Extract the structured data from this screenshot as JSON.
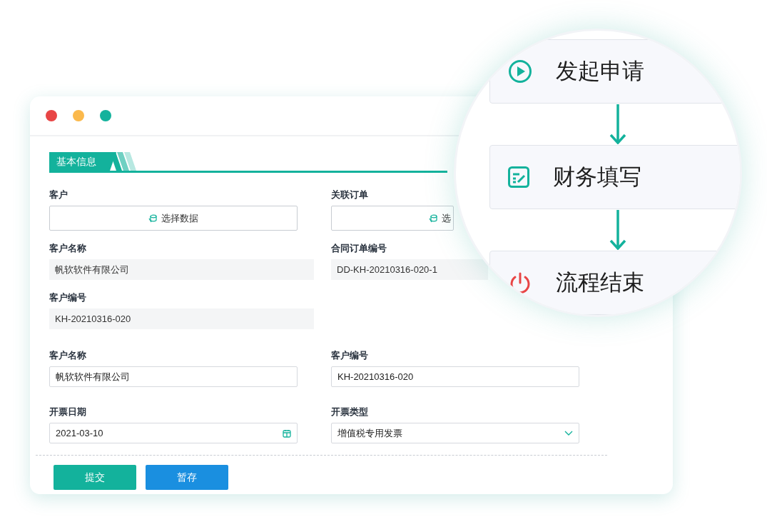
{
  "window": {
    "controls": [
      {
        "color": "#e84545"
      },
      {
        "color": "#fbb94c"
      },
      {
        "color": "#13b29c"
      }
    ]
  },
  "section": {
    "title": "基本信息"
  },
  "rows": [
    {
      "fields": [
        {
          "kind": "picker",
          "label": "客户",
          "button": "选择数据"
        },
        {
          "kind": "picker",
          "label": "关联订单",
          "button": "选"
        }
      ]
    },
    {
      "fields": [
        {
          "kind": "readonly",
          "label": "客户名称",
          "value": "帆软软件有限公司"
        },
        {
          "kind": "readonly",
          "label": "合同订单编号",
          "value": "DD-KH-20210316-020-1"
        }
      ]
    },
    {
      "fields": [
        {
          "kind": "readonly",
          "label": "客户编号",
          "value": "KH-20210316-020"
        }
      ]
    },
    {
      "fields": [
        {
          "kind": "input",
          "label": "客户名称",
          "value": "帆软软件有限公司"
        },
        {
          "kind": "input",
          "label": "客户编号",
          "value": "KH-20210316-020"
        }
      ]
    },
    {
      "fields": [
        {
          "kind": "date",
          "label": "开票日期",
          "value": "2021-03-10"
        },
        {
          "kind": "select",
          "label": "开票类型",
          "value": "增值税专用发票"
        }
      ]
    }
  ],
  "buttons": [
    {
      "kind": "primary",
      "label": "提交"
    },
    {
      "kind": "secondary",
      "label": "暂存"
    }
  ],
  "flow": {
    "steps": [
      {
        "kind": "start",
        "label": "发起申请"
      },
      {
        "kind": "edit",
        "label": "财务填写"
      },
      {
        "kind": "end",
        "label": "流程结束"
      }
    ]
  }
}
